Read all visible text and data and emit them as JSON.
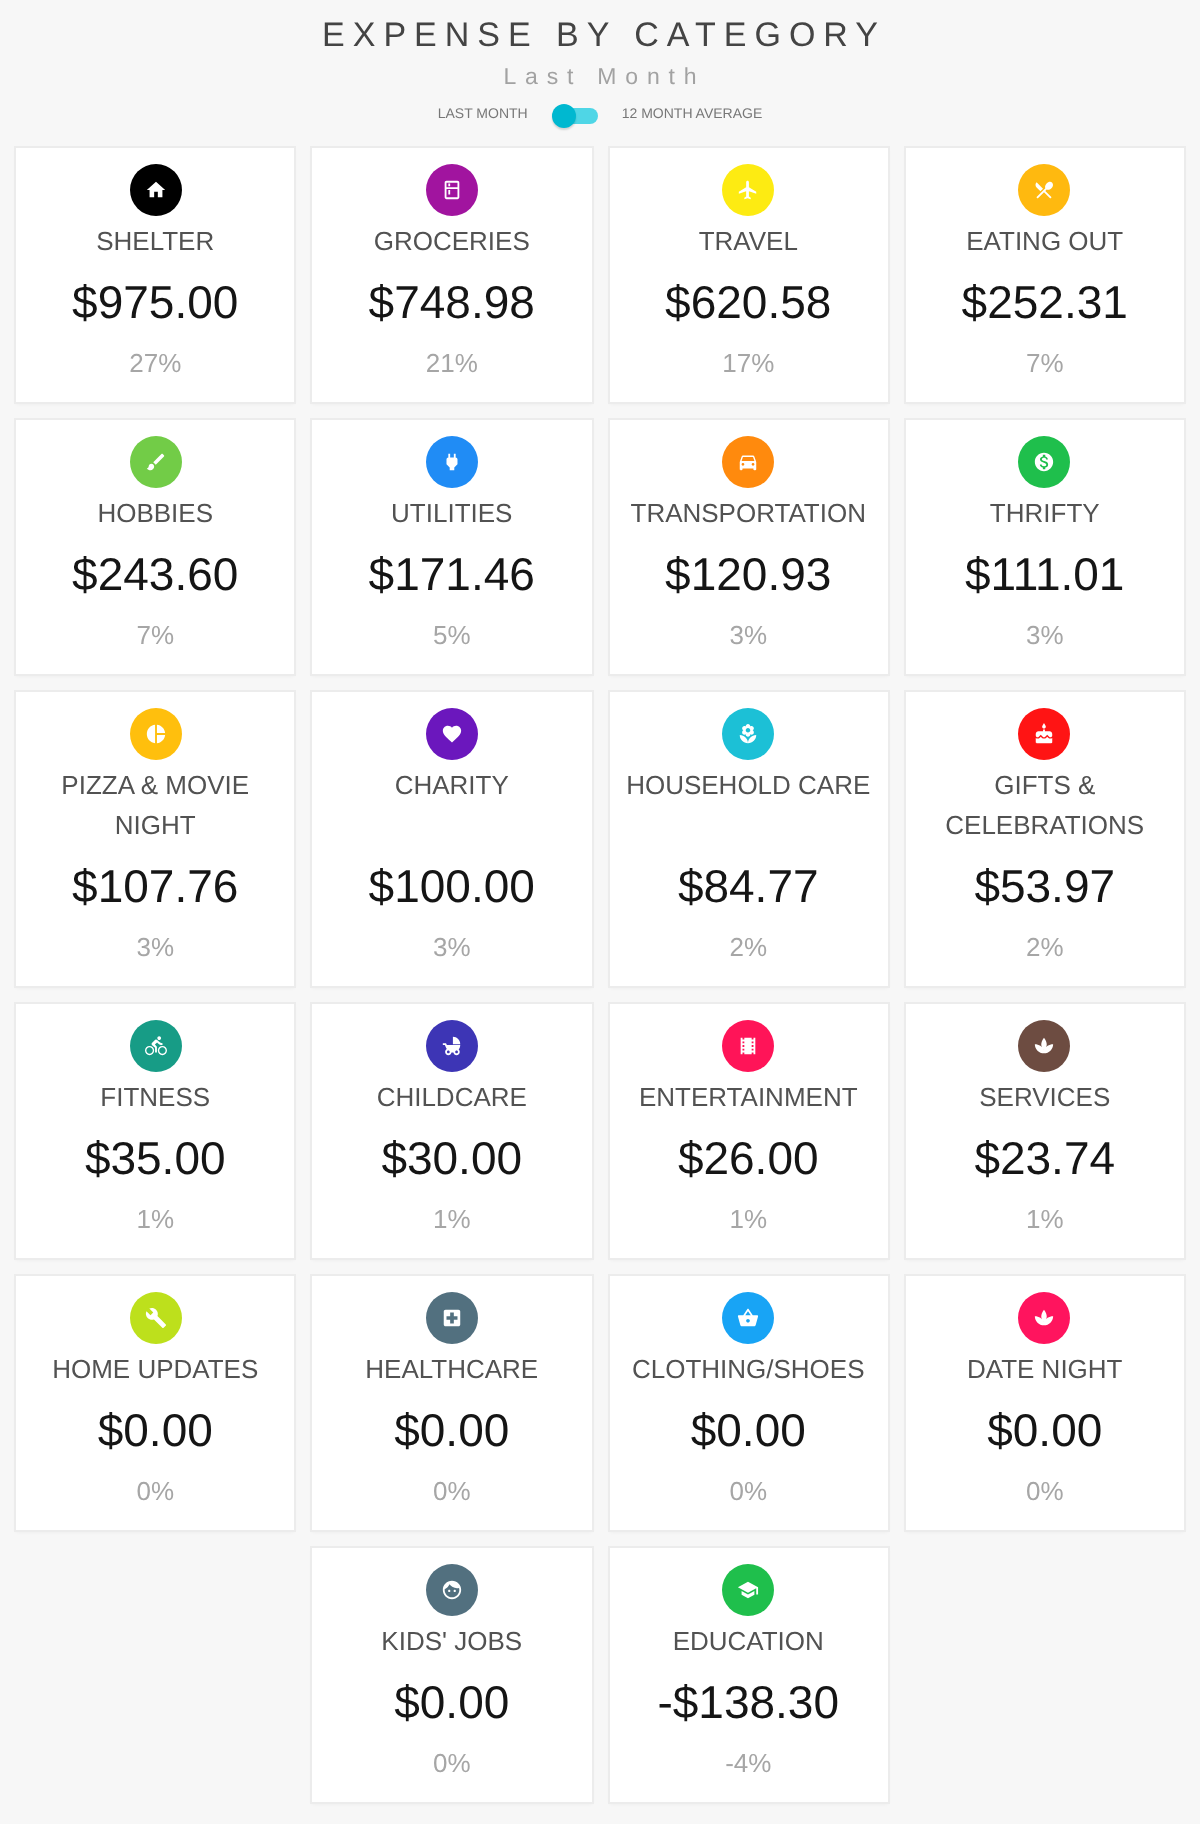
{
  "header": {
    "title": "EXPENSE BY CATEGORY",
    "subtitle": "Last Month"
  },
  "period_toggle": {
    "left_label": "LAST MONTH",
    "right_label": "12 MONTH AVERAGE",
    "on": false
  },
  "categories": [
    {
      "kind": "house",
      "color": "#000000",
      "name": "SHELTER",
      "amount": "$975.00",
      "percent": "27%"
    },
    {
      "kind": "fridge",
      "color": "#a1149f",
      "name": "GROCERIES",
      "amount": "$748.98",
      "percent": "21%"
    },
    {
      "kind": "plane",
      "color": "#fdeb12",
      "name": "TRAVEL",
      "amount": "$620.58",
      "percent": "17%"
    },
    {
      "kind": "utensils",
      "color": "#ffb90f",
      "name": "EATING OUT",
      "amount": "$252.31",
      "percent": "7%"
    },
    {
      "kind": "brush",
      "color": "#72cc47",
      "name": "HOBBIES",
      "amount": "$243.60",
      "percent": "7%"
    },
    {
      "kind": "plug",
      "color": "#208cf5",
      "name": "UTILITIES",
      "amount": "$171.46",
      "percent": "5%"
    },
    {
      "kind": "car",
      "color": "#ff8a0d",
      "name": "TRANSPORTATION",
      "amount": "$120.93",
      "percent": "3%"
    },
    {
      "kind": "dollar",
      "color": "#1fbf4c",
      "name": "THRIFTY",
      "amount": "$111.01",
      "percent": "3%"
    },
    {
      "kind": "pie",
      "color": "#ffbf0d",
      "name": "PIZZA & MOVIE NIGHT",
      "amount": "$107.76",
      "percent": "3%"
    },
    {
      "kind": "heart",
      "color": "#6b17bd",
      "name": "CHARITY",
      "amount": "$100.00",
      "percent": "3%"
    },
    {
      "kind": "flower",
      "color": "#1cc0d6",
      "name": "HOUSEHOLD CARE",
      "amount": "$84.77",
      "percent": "2%"
    },
    {
      "kind": "cake",
      "color": "#ff1414",
      "name": "GIFTS & CELEBRATIONS",
      "amount": "$53.97",
      "percent": "2%"
    },
    {
      "kind": "bike",
      "color": "#179c86",
      "name": "FITNESS",
      "amount": "$35.00",
      "percent": "1%"
    },
    {
      "kind": "stroller",
      "color": "#3d35b5",
      "name": "CHILDCARE",
      "amount": "$30.00",
      "percent": "1%"
    },
    {
      "kind": "film",
      "color": "#ff1458",
      "name": "ENTERTAINMENT",
      "amount": "$26.00",
      "percent": "1%"
    },
    {
      "kind": "spa",
      "color": "#6d4c41",
      "name": "SERVICES",
      "amount": "$23.74",
      "percent": "1%"
    },
    {
      "kind": "wrench",
      "color": "#bde01c",
      "name": "HOME UPDATES",
      "amount": "$0.00",
      "percent": "0%"
    },
    {
      "kind": "medkit",
      "color": "#52707f",
      "name": "HEALTHCARE",
      "amount": "$0.00",
      "percent": "0%"
    },
    {
      "kind": "basket",
      "color": "#18a4f5",
      "name": "CLOTHING/SHOES",
      "amount": "$0.00",
      "percent": "0%"
    },
    {
      "kind": "spa",
      "color": "#ff145e",
      "name": "DATE NIGHT",
      "amount": "$0.00",
      "percent": "0%"
    },
    {
      "kind": "face",
      "color": "#52707f",
      "name": "KIDS' JOBS",
      "amount": "$0.00",
      "percent": "0%"
    },
    {
      "kind": "cap",
      "color": "#1fbf4c",
      "name": "EDUCATION",
      "amount": "-$138.30",
      "percent": "-4%"
    }
  ]
}
